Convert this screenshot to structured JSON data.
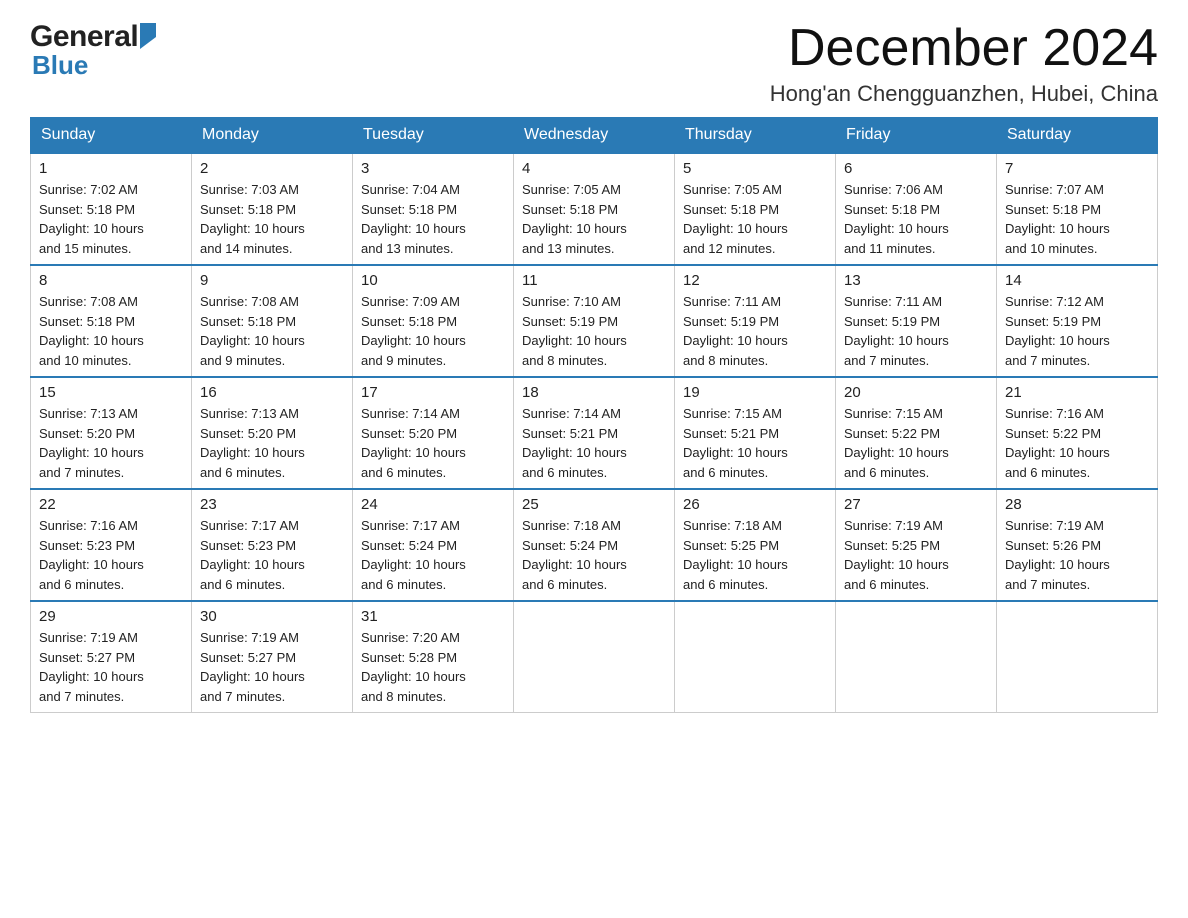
{
  "logo": {
    "name_black": "General",
    "name_blue": "Blue"
  },
  "header": {
    "month": "December 2024",
    "location": "Hong'an Chengguanzhen, Hubei, China"
  },
  "weekdays": [
    "Sunday",
    "Monday",
    "Tuesday",
    "Wednesday",
    "Thursday",
    "Friday",
    "Saturday"
  ],
  "weeks": [
    [
      {
        "day": "1",
        "sunrise": "7:02 AM",
        "sunset": "5:18 PM",
        "daylight": "10 hours and 15 minutes."
      },
      {
        "day": "2",
        "sunrise": "7:03 AM",
        "sunset": "5:18 PM",
        "daylight": "10 hours and 14 minutes."
      },
      {
        "day": "3",
        "sunrise": "7:04 AM",
        "sunset": "5:18 PM",
        "daylight": "10 hours and 13 minutes."
      },
      {
        "day": "4",
        "sunrise": "7:05 AM",
        "sunset": "5:18 PM",
        "daylight": "10 hours and 13 minutes."
      },
      {
        "day": "5",
        "sunrise": "7:05 AM",
        "sunset": "5:18 PM",
        "daylight": "10 hours and 12 minutes."
      },
      {
        "day": "6",
        "sunrise": "7:06 AM",
        "sunset": "5:18 PM",
        "daylight": "10 hours and 11 minutes."
      },
      {
        "day": "7",
        "sunrise": "7:07 AM",
        "sunset": "5:18 PM",
        "daylight": "10 hours and 10 minutes."
      }
    ],
    [
      {
        "day": "8",
        "sunrise": "7:08 AM",
        "sunset": "5:18 PM",
        "daylight": "10 hours and 10 minutes."
      },
      {
        "day": "9",
        "sunrise": "7:08 AM",
        "sunset": "5:18 PM",
        "daylight": "10 hours and 9 minutes."
      },
      {
        "day": "10",
        "sunrise": "7:09 AM",
        "sunset": "5:18 PM",
        "daylight": "10 hours and 9 minutes."
      },
      {
        "day": "11",
        "sunrise": "7:10 AM",
        "sunset": "5:19 PM",
        "daylight": "10 hours and 8 minutes."
      },
      {
        "day": "12",
        "sunrise": "7:11 AM",
        "sunset": "5:19 PM",
        "daylight": "10 hours and 8 minutes."
      },
      {
        "day": "13",
        "sunrise": "7:11 AM",
        "sunset": "5:19 PM",
        "daylight": "10 hours and 7 minutes."
      },
      {
        "day": "14",
        "sunrise": "7:12 AM",
        "sunset": "5:19 PM",
        "daylight": "10 hours and 7 minutes."
      }
    ],
    [
      {
        "day": "15",
        "sunrise": "7:13 AM",
        "sunset": "5:20 PM",
        "daylight": "10 hours and 7 minutes."
      },
      {
        "day": "16",
        "sunrise": "7:13 AM",
        "sunset": "5:20 PM",
        "daylight": "10 hours and 6 minutes."
      },
      {
        "day": "17",
        "sunrise": "7:14 AM",
        "sunset": "5:20 PM",
        "daylight": "10 hours and 6 minutes."
      },
      {
        "day": "18",
        "sunrise": "7:14 AM",
        "sunset": "5:21 PM",
        "daylight": "10 hours and 6 minutes."
      },
      {
        "day": "19",
        "sunrise": "7:15 AM",
        "sunset": "5:21 PM",
        "daylight": "10 hours and 6 minutes."
      },
      {
        "day": "20",
        "sunrise": "7:15 AM",
        "sunset": "5:22 PM",
        "daylight": "10 hours and 6 minutes."
      },
      {
        "day": "21",
        "sunrise": "7:16 AM",
        "sunset": "5:22 PM",
        "daylight": "10 hours and 6 minutes."
      }
    ],
    [
      {
        "day": "22",
        "sunrise": "7:16 AM",
        "sunset": "5:23 PM",
        "daylight": "10 hours and 6 minutes."
      },
      {
        "day": "23",
        "sunrise": "7:17 AM",
        "sunset": "5:23 PM",
        "daylight": "10 hours and 6 minutes."
      },
      {
        "day": "24",
        "sunrise": "7:17 AM",
        "sunset": "5:24 PM",
        "daylight": "10 hours and 6 minutes."
      },
      {
        "day": "25",
        "sunrise": "7:18 AM",
        "sunset": "5:24 PM",
        "daylight": "10 hours and 6 minutes."
      },
      {
        "day": "26",
        "sunrise": "7:18 AM",
        "sunset": "5:25 PM",
        "daylight": "10 hours and 6 minutes."
      },
      {
        "day": "27",
        "sunrise": "7:19 AM",
        "sunset": "5:25 PM",
        "daylight": "10 hours and 6 minutes."
      },
      {
        "day": "28",
        "sunrise": "7:19 AM",
        "sunset": "5:26 PM",
        "daylight": "10 hours and 7 minutes."
      }
    ],
    [
      {
        "day": "29",
        "sunrise": "7:19 AM",
        "sunset": "5:27 PM",
        "daylight": "10 hours and 7 minutes."
      },
      {
        "day": "30",
        "sunrise": "7:19 AM",
        "sunset": "5:27 PM",
        "daylight": "10 hours and 7 minutes."
      },
      {
        "day": "31",
        "sunrise": "7:20 AM",
        "sunset": "5:28 PM",
        "daylight": "10 hours and 8 minutes."
      },
      null,
      null,
      null,
      null
    ]
  ],
  "labels": {
    "sunrise": "Sunrise:",
    "sunset": "Sunset:",
    "daylight": "Daylight:"
  }
}
